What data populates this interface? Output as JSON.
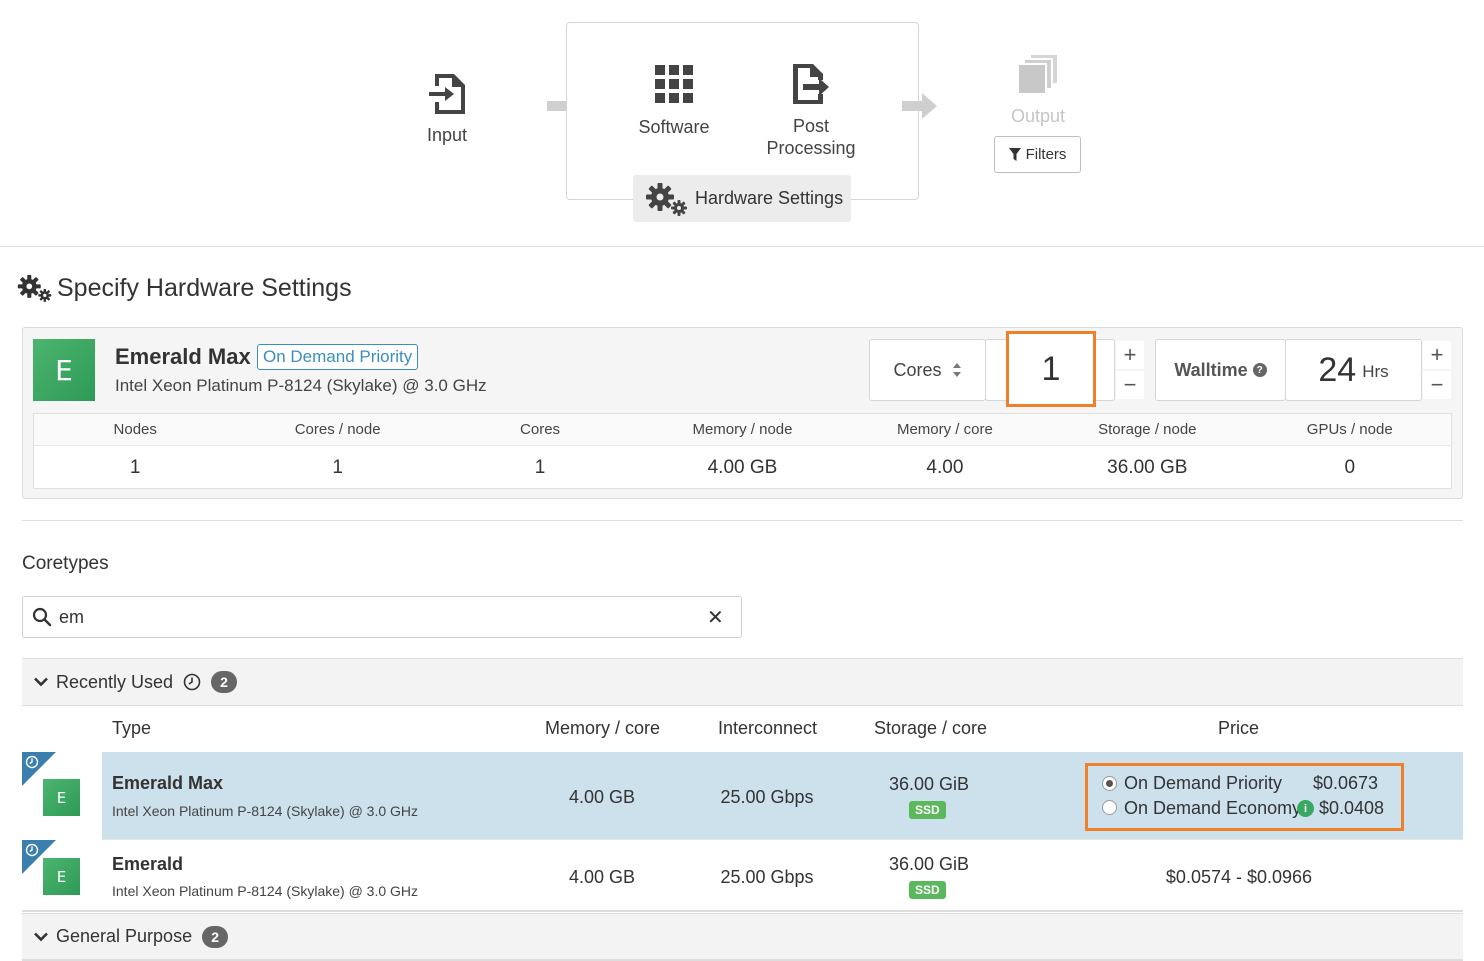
{
  "workflow": {
    "input_label": "Input",
    "software_label": "Software",
    "post_line1": "Post",
    "post_line2": "Processing",
    "output_label": "Output",
    "filters_label": "Filters",
    "hardware_tab_label": "Hardware Settings"
  },
  "section_title": "Specify Hardware Settings",
  "selected": {
    "logo_letter": "E",
    "name": "Emerald Max",
    "badge": "On Demand Priority",
    "cpu": "Intel Xeon Platinum P-8124 (Skylake) @ 3.0 GHz",
    "cores_selector_label": "Cores",
    "cores_value": "1",
    "walltime_label": "Walltime",
    "walltime_value": "24",
    "walltime_unit": "Hrs",
    "plus": "+",
    "minus": "−"
  },
  "specs": {
    "headers": [
      "Nodes",
      "Cores / node",
      "Cores",
      "Memory / node",
      "Memory / core",
      "Storage / node",
      "GPUs / node"
    ],
    "values": [
      "1",
      "1",
      "1",
      "4.00 GB",
      "4.00",
      "36.00 GB",
      "0"
    ]
  },
  "coretypes": {
    "label": "Coretypes",
    "search_value": "em",
    "clear_icon": "✕"
  },
  "groups": {
    "recent": {
      "label": "Recently Used",
      "count": "2"
    },
    "general": {
      "label": "General Purpose",
      "count": "2"
    }
  },
  "table": {
    "headers": {
      "type": "Type",
      "memory": "Memory / core",
      "interconnect": "Interconnect",
      "storage": "Storage / core",
      "price": "Price"
    },
    "rows": [
      {
        "logo_letter": "E",
        "name": "Emerald Max",
        "cpu": "Intel Xeon Platinum P-8124 (Skylake) @ 3.0 GHz",
        "memory": "4.00 GB",
        "interconnect": "25.00 Gbps",
        "storage": "36.00 GiB",
        "storage_tag": "SSD",
        "price_options": [
          {
            "label": "On Demand Priority",
            "price": "$0.0673",
            "selected": true
          },
          {
            "label": "On Demand Economy",
            "price": "$0.0408",
            "selected": false
          }
        ]
      },
      {
        "logo_letter": "E",
        "name": "Emerald",
        "cpu": "Intel Xeon Platinum P-8124 (Skylake) @ 3.0 GHz",
        "memory": "4.00 GB",
        "interconnect": "25.00 Gbps",
        "storage": "36.00 GiB",
        "storage_tag": "SSD",
        "price_range": "$0.0574 - $0.0966"
      }
    ]
  },
  "colors": {
    "accent_orange": "#f07f2a",
    "selected_row": "#cde1ec",
    "logo_green": "#3aa862",
    "badge_blue": "#3a8fbf",
    "ssd_green": "#5cb85c"
  }
}
